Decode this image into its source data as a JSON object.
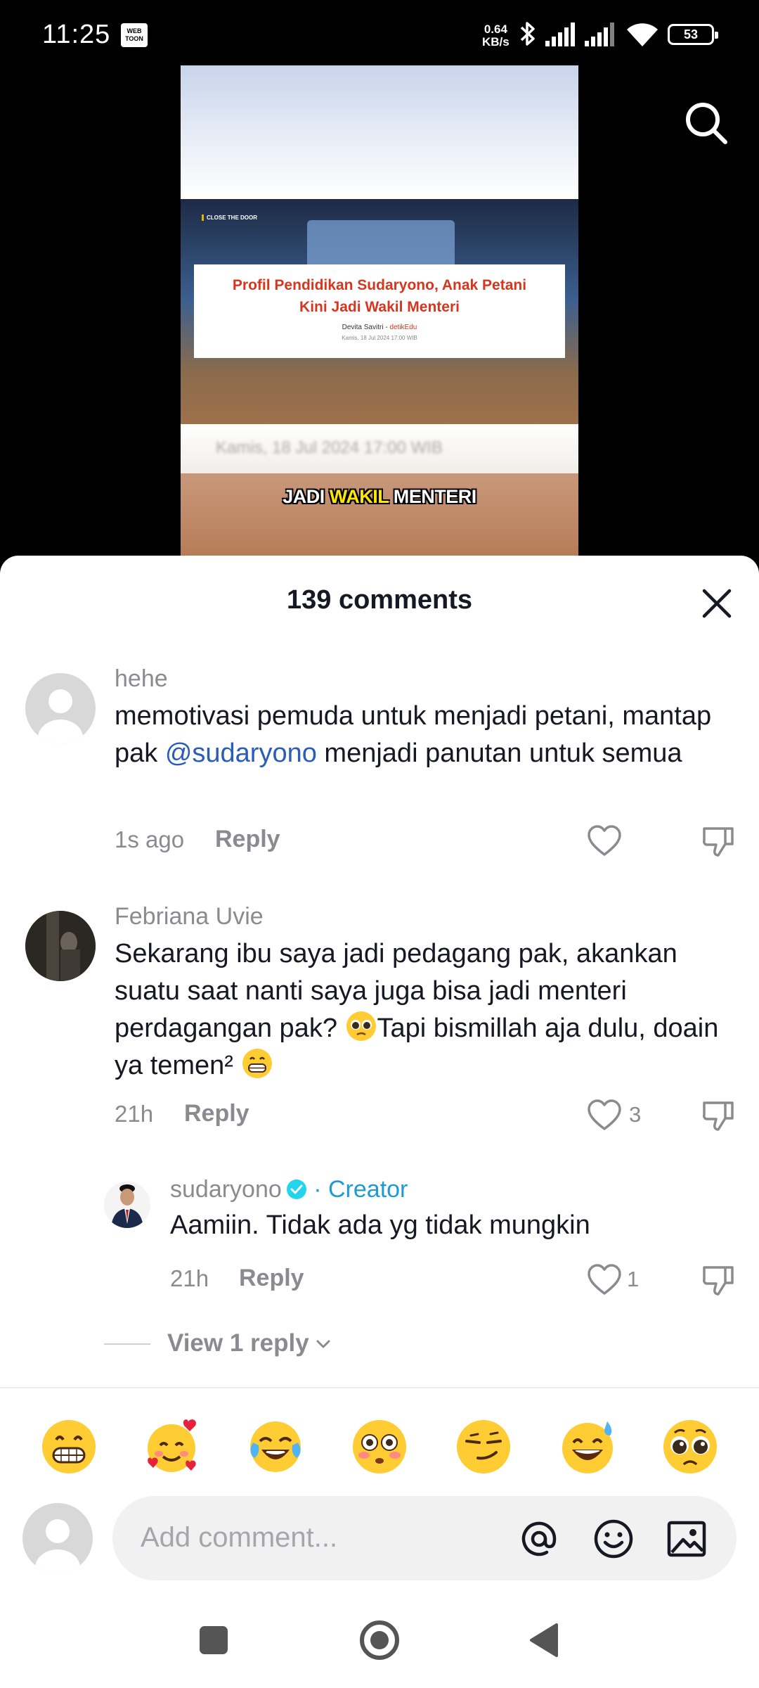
{
  "status_bar": {
    "time": "11:25",
    "app_badge": "WEB TOON",
    "net_speed_value": "0.64",
    "net_speed_unit": "KB/s",
    "battery": "53"
  },
  "video": {
    "logo_text": "CLOSE THE DOOR",
    "news_title": "Profil Pendidikan Sudaryono, Anak Petani Kini Jadi Wakil Menteri",
    "news_author": "Devita Savitri",
    "news_source": "detikEdu",
    "news_date": "Kamis, 18 Jul 2024 17:00 WIB",
    "band_text": "Kamis, 18 Jul 2024 17:00 WIB",
    "caption_part1": "JADI ",
    "caption_highlight": "WAKIL",
    "caption_part2": " MENTERI"
  },
  "comments_sheet": {
    "title": "139 comments",
    "comments": [
      {
        "user": "hehe",
        "text_before_mention": "memotivasi pemuda untuk menjadi petani, mantap pak ",
        "mention": "@sudaryono",
        "text_after_mention": " menjadi panutan untuk semua",
        "time": "1s ago",
        "reply_label": "Reply",
        "likes": ""
      },
      {
        "user": "Febriana Uvie",
        "text_part1": "Sekarang ibu saya jadi pedagang pak, akankan suatu saat nanti saya juga bisa jadi menteri perdagangan pak? ",
        "text_part2": "Tapi bismillah aja dulu, doain ya temen² ",
        "time": "21h",
        "reply_label": "Reply",
        "likes": "3"
      },
      {
        "user": "sudaryono",
        "creator_label": "· Creator",
        "text": "Aamiin. Tidak ada yg tidak mungkin",
        "time": "21h",
        "reply_label": "Reply",
        "likes": "1"
      }
    ],
    "view_replies": "View 1 reply"
  },
  "emoji_bar": [
    "grinning-face",
    "smiling-face-with-hearts",
    "face-with-tears-of-joy",
    "flushed-face",
    "smirking-face",
    "grinning-face-with-sweat",
    "pleading-face"
  ],
  "comment_input": {
    "placeholder": "Add comment..."
  },
  "colors": {
    "mention": "#2b5db8",
    "creator": "#1d9bd3",
    "news_red": "#d6361f",
    "caption_highlight": "#ffe600"
  }
}
